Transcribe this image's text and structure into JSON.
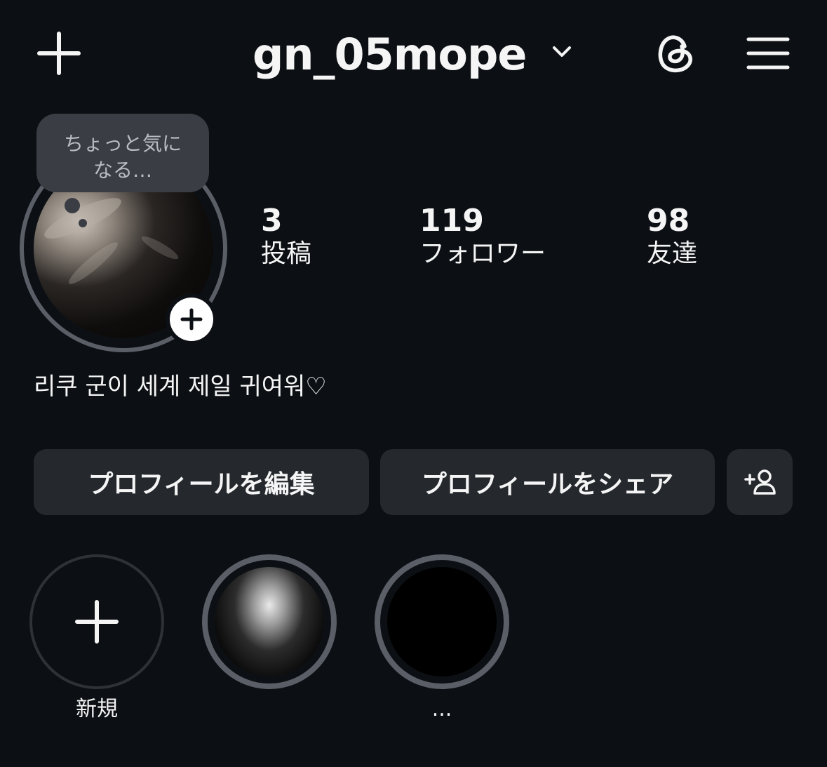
{
  "header": {
    "username": "gn_05mope"
  },
  "note": {
    "text": "ちょっと気になる…"
  },
  "stats": [
    {
      "count": "3",
      "label": "投稿"
    },
    {
      "count": "119",
      "label": "フォロワー"
    },
    {
      "count": "98",
      "label": "友達"
    }
  ],
  "bio": "리쿠 군이 세계 제일 귀여워♡",
  "buttons": {
    "edit": "プロフィールを編集",
    "share": "プロフィールをシェア"
  },
  "highlights": [
    {
      "label": "新規"
    },
    {
      "label": ""
    },
    {
      "label": "..."
    }
  ],
  "colors": {
    "background": "#0c1014",
    "button": "#25292e",
    "ring": "#5a5e66",
    "note_bubble": "#3a3d43"
  }
}
